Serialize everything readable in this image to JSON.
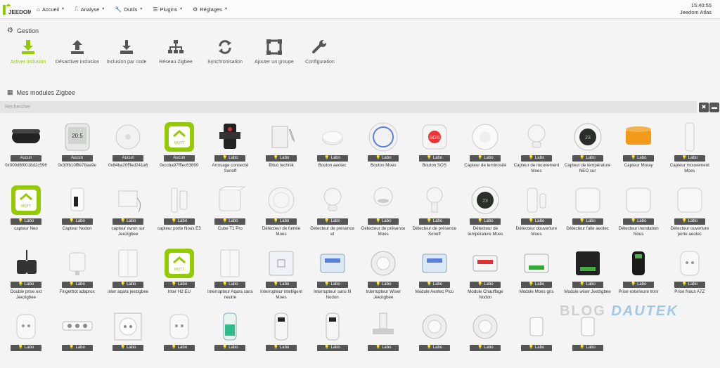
{
  "app": {
    "logo_text": "JEEDOM"
  },
  "nav": {
    "items": [
      {
        "icon": "home-icon",
        "label": "Accueil"
      },
      {
        "icon": "chart-icon",
        "label": "Analyse"
      },
      {
        "icon": "wrench-icon",
        "label": "Outils"
      },
      {
        "icon": "list-icon",
        "label": "Plugins"
      },
      {
        "icon": "gear-icon",
        "label": "Réglages"
      }
    ],
    "time": "15:40:55",
    "system_name": "Jeedom Atlas"
  },
  "gestion": {
    "title": "Gestion",
    "tiles": [
      {
        "label": "Activer inclusion",
        "icon": "download-icon",
        "active": true
      },
      {
        "label": "Désactiver inclusion",
        "icon": "upload-icon"
      },
      {
        "label": "Inclusion par code",
        "icon": "download-tray-icon"
      },
      {
        "label": "Réseau Zigbee",
        "icon": "network-icon"
      },
      {
        "label": "Synchronisation",
        "icon": "sync-icon"
      },
      {
        "label": "Ajouter un groupe",
        "icon": "group-icon"
      },
      {
        "label": "Configuration",
        "icon": "wrench-icon"
      }
    ]
  },
  "modules": {
    "title": "Mes modules Zigbee",
    "search_placeholder": "Rechercher",
    "rows": [
      [
        {
          "name": "0x000d6f0018d2c596",
          "badge": "Aucun",
          "thumb": "hub-black"
        },
        {
          "name": "0x30fb10fffe78aa9e",
          "badge": "Aucun",
          "thumb": "lcd-sensor"
        },
        {
          "name": "0x84ba20fffed241a6",
          "badge": "Aucun",
          "thumb": "round-white"
        },
        {
          "name": "0xccba97fffec63800",
          "badge": "Aucun",
          "thumb": "mqtt-green"
        },
        {
          "name": "Arrosage connecté Sonoff",
          "badge": "Labo",
          "thumb": "valve-black"
        },
        {
          "name": "Bituo technik",
          "badge": "Labo",
          "thumb": "din-white"
        },
        {
          "name": "Bouton aeotec",
          "badge": "Labo",
          "thumb": "button-flat"
        },
        {
          "name": "Bouton Moes",
          "badge": "Labo",
          "thumb": "ring-blue"
        },
        {
          "name": "Bouton SOS",
          "badge": "Labo",
          "thumb": "sos"
        },
        {
          "name": "Capteur de luminosité",
          "badge": "Labo",
          "thumb": "dome-white"
        },
        {
          "name": "Capteur de mouvement Moes",
          "badge": "Labo",
          "thumb": "ball-white"
        },
        {
          "name": "Capteur de température NEO sur",
          "badge": "Labo",
          "thumb": "lcd-round"
        },
        {
          "name": "Capteur Moray",
          "badge": "Labo",
          "thumb": "orange-cyl"
        },
        {
          "name": "Capteur mouvement Moes",
          "badge": "Labo",
          "thumb": "tall-white"
        }
      ],
      [
        {
          "name": "capteur Neo",
          "badge": "Labo",
          "thumb": "mqtt-green"
        },
        {
          "name": "Capteur Nodon",
          "badge": "Labo",
          "thumb": "small-black"
        },
        {
          "name": "capteur owon sur Jeezigbee",
          "badge": "Labo",
          "thumb": "box-cable"
        },
        {
          "name": "capteur porte Nous E3",
          "badge": "Labo",
          "thumb": "slim-white"
        },
        {
          "name": "Cube T1 Pro",
          "badge": "Labo",
          "thumb": "cube"
        },
        {
          "name": "Détecteur de fumée Moes",
          "badge": "Labo",
          "thumb": "smoke"
        },
        {
          "name": "Détecteur de présence et",
          "badge": "Labo",
          "thumb": "ball-white"
        },
        {
          "name": "Détecteur de présence Moes",
          "badge": "Labo",
          "thumb": "ceiling"
        },
        {
          "name": "Détecteur de présence Sonoff",
          "badge": "Labo",
          "thumb": "stand-white"
        },
        {
          "name": "Détecteur de température Moes",
          "badge": "Labo",
          "thumb": "lcd-round"
        },
        {
          "name": "Détecteur douverture Moes",
          "badge": "Labo",
          "thumb": "door-sensor"
        },
        {
          "name": "Détecteur fuite aeotec",
          "badge": "Labo",
          "thumb": "square-white"
        },
        {
          "name": "Détecteur inondation Nous",
          "badge": "Labo",
          "thumb": "square-white"
        },
        {
          "name": "Détecteur ouverture porte aeotec",
          "badge": "Labo",
          "thumb": "square-white"
        }
      ],
      [
        {
          "name": "Double prise ext Jeezigbee",
          "badge": "Labo",
          "thumb": "double-plug"
        },
        {
          "name": "Fingerbot adaprox",
          "badge": "Labo",
          "thumb": "fingerbot"
        },
        {
          "name": "inter aqara jeezigbee",
          "badge": "Labo",
          "thumb": "switch-white"
        },
        {
          "name": "Inter H2 EU",
          "badge": "Labo",
          "thumb": "mqtt-green"
        },
        {
          "name": "Interrupteur Aqara sans neutre",
          "badge": "Labo",
          "thumb": "switch-white"
        },
        {
          "name": "Interrupteur intelligent Moes",
          "badge": "Labo",
          "thumb": "glass-switch"
        },
        {
          "name": "Interrupteur sans fil Nodon",
          "badge": "Labo",
          "thumb": "module-blue"
        },
        {
          "name": "Interrupteur Wiser Jeezigbee",
          "badge": "Labo",
          "thumb": "dimmer"
        },
        {
          "name": "Module Aeotec Pico",
          "badge": "Labo",
          "thumb": "module-blue"
        },
        {
          "name": "Module Chauffage Nodon",
          "badge": "Labo",
          "thumb": "module-red"
        },
        {
          "name": "Module Moes gris",
          "badge": "Labo",
          "thumb": "module-green"
        },
        {
          "name": "Module wiser Jeezigbee",
          "badge": "Labo",
          "thumb": "module-black"
        },
        {
          "name": "Prise exterieure lmnr",
          "badge": "Labo",
          "thumb": "outdoor-plug"
        },
        {
          "name": "Prise Nous A7Z",
          "badge": "Labo",
          "thumb": "plug-white"
        }
      ],
      [
        {
          "name": "",
          "badge": "Labo",
          "thumb": "plug-white"
        },
        {
          "name": "",
          "badge": "Labo",
          "thumb": "power-strip"
        },
        {
          "name": "",
          "badge": "Labo",
          "thumb": "socket"
        },
        {
          "name": "",
          "badge": "Labo",
          "thumb": "plug-white"
        },
        {
          "name": "",
          "badge": "Labo",
          "thumb": "water-green"
        },
        {
          "name": "",
          "badge": "Labo",
          "thumb": "trv"
        },
        {
          "name": "",
          "badge": "Labo",
          "thumb": "trv"
        },
        {
          "name": "",
          "badge": "Labo",
          "thumb": "valve-white"
        },
        {
          "name": "",
          "badge": "Labo",
          "thumb": "dimmer"
        },
        {
          "name": "",
          "badge": "Labo",
          "thumb": "dimmer"
        },
        {
          "name": "",
          "badge": "Labo",
          "thumb": "small-white"
        },
        {
          "name": "",
          "badge": "Labo",
          "thumb": "small-white"
        }
      ]
    ]
  },
  "watermark": {
    "part1": "BLOG",
    "part2": "DAUTEK"
  }
}
